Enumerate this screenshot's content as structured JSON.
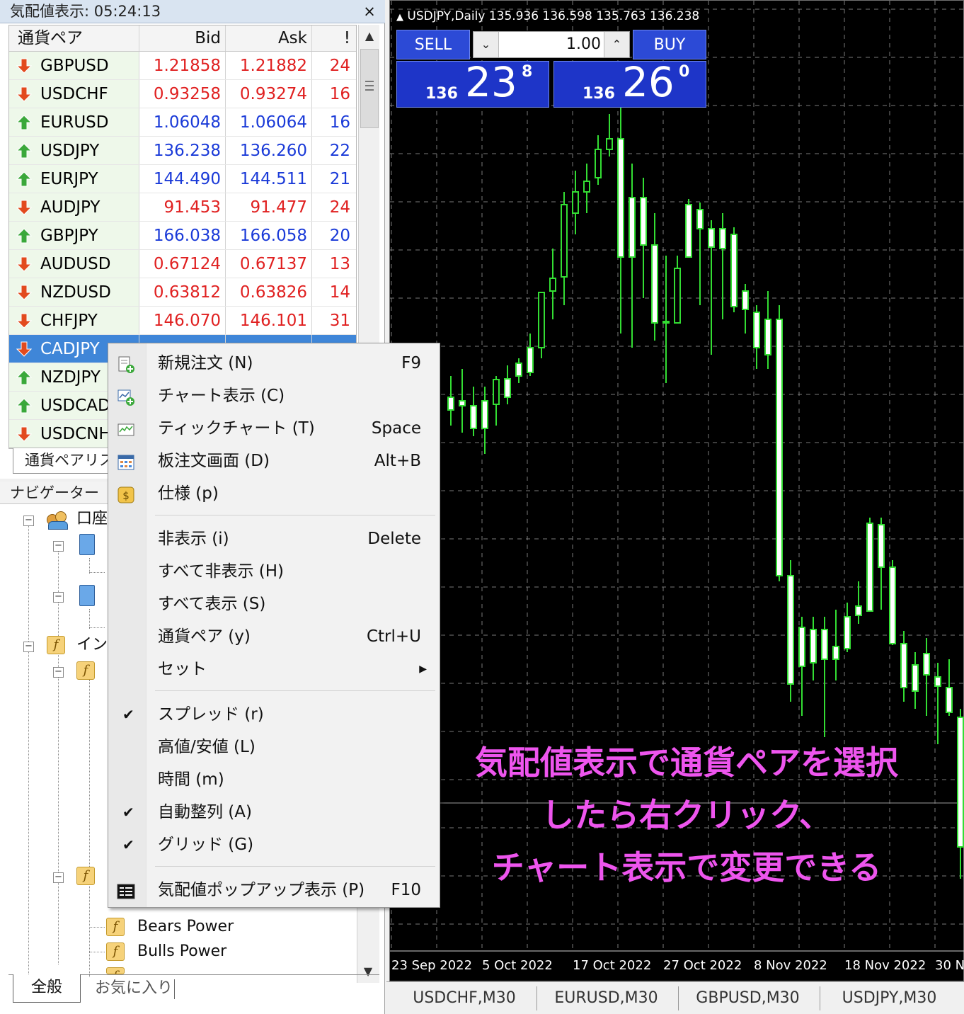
{
  "market_watch": {
    "title": "気配値表示: 05:24:13",
    "close": "×",
    "columns": [
      "通貨ペア",
      "Bid",
      "Ask",
      "!"
    ],
    "rows": [
      {
        "symbol": "GBPUSD",
        "bid": "1.21858",
        "ask": "1.21882",
        "spread": "24",
        "dir": "down"
      },
      {
        "symbol": "USDCHF",
        "bid": "0.93258",
        "ask": "0.93274",
        "spread": "16",
        "dir": "down"
      },
      {
        "symbol": "EURUSD",
        "bid": "1.06048",
        "ask": "1.06064",
        "spread": "16",
        "dir": "up"
      },
      {
        "symbol": "USDJPY",
        "bid": "136.238",
        "ask": "136.260",
        "spread": "22",
        "dir": "up"
      },
      {
        "symbol": "EURJPY",
        "bid": "144.490",
        "ask": "144.511",
        "spread": "21",
        "dir": "up"
      },
      {
        "symbol": "AUDJPY",
        "bid": "91.453",
        "ask": "91.477",
        "spread": "24",
        "dir": "down"
      },
      {
        "symbol": "GBPJPY",
        "bid": "166.038",
        "ask": "166.058",
        "spread": "20",
        "dir": "up"
      },
      {
        "symbol": "AUDUSD",
        "bid": "0.67124",
        "ask": "0.67137",
        "spread": "13",
        "dir": "down"
      },
      {
        "symbol": "NZDUSD",
        "bid": "0.63812",
        "ask": "0.63826",
        "spread": "14",
        "dir": "down"
      },
      {
        "symbol": "CHFJPY",
        "bid": "146.070",
        "ask": "146.101",
        "spread": "31",
        "dir": "down"
      },
      {
        "symbol": "CADJPY",
        "bid": "",
        "ask": "",
        "spread": "",
        "dir": "down",
        "selected": true
      },
      {
        "symbol": "NZDJPY",
        "bid": "",
        "ask": "",
        "spread": "",
        "dir": "up"
      },
      {
        "symbol": "USDCAD",
        "bid": "",
        "ask": "",
        "spread": "",
        "dir": "up"
      },
      {
        "symbol": "USDCNH",
        "bid": "",
        "ask": "",
        "spread": "",
        "dir": "down"
      }
    ],
    "tab": "通貨ペアリス"
  },
  "navigator": {
    "title": "ナビゲーター",
    "items": [
      "口座",
      "イン",
      "Bears Power",
      "Bulls Power"
    ],
    "tabs": [
      "全般",
      "お気に入り"
    ]
  },
  "chart": {
    "header": "USDJPY,Daily  135.936 136.598 135.763 136.238",
    "sell_label": "SELL",
    "buy_label": "BUY",
    "lots": "1.00",
    "sell_price": {
      "small": "136",
      "big": "23",
      "sup": "8"
    },
    "buy_price": {
      "small": "136",
      "big": "26",
      "sup": "0"
    },
    "date_labels": [
      "23 Sep 2022",
      "5 Oct 2022",
      "17 Oct 2022",
      "27 Oct 2022",
      "8 Nov 2022",
      "18 Nov 2022",
      "30 No"
    ],
    "tabs": [
      "USDCHF,M30",
      "EURUSD,M30",
      "GBPUSD,M30",
      "USDJPY,M30"
    ],
    "annotation": [
      "気配値表示で通貨ペアを選択",
      "したら右クリック、",
      "チャート表示で変更できる"
    ],
    "colors": {
      "up_candle": "#ffffff",
      "down_candle": "#000000",
      "wick": "#33dd33",
      "grid": "#7a7a7a",
      "background": "#000000"
    }
  },
  "context_menu": {
    "items": [
      {
        "label": "新規注文 (N)",
        "shortcut": "F9",
        "icon": "new-order-icon"
      },
      {
        "label": "チャート表示 (C)",
        "shortcut": "",
        "icon": "chart-window-icon"
      },
      {
        "label": "ティックチャート (T)",
        "shortcut": "Space",
        "icon": "tick-chart-icon"
      },
      {
        "label": "板注文画面 (D)",
        "shortcut": "Alt+B",
        "icon": "depth-of-market-icon"
      },
      {
        "label": "仕様 (p)",
        "shortcut": "",
        "icon": "specification-icon"
      },
      {
        "label": "非表示 (i)",
        "shortcut": "Delete"
      },
      {
        "label": "すべて非表示 (H)",
        "shortcut": ""
      },
      {
        "label": "すべて表示 (S)",
        "shortcut": ""
      },
      {
        "label": "通貨ペア (y)",
        "shortcut": "Ctrl+U"
      },
      {
        "label": "セット",
        "shortcut": "",
        "submenu": true
      },
      {
        "label": "スプレッド (r)",
        "shortcut": "",
        "checked": true
      },
      {
        "label": "高値/安値 (L)",
        "shortcut": ""
      },
      {
        "label": "時間 (m)",
        "shortcut": ""
      },
      {
        "label": "自動整列 (A)",
        "shortcut": "",
        "checked": true
      },
      {
        "label": "グリッド (G)",
        "shortcut": "",
        "checked": true
      },
      {
        "label": "気配値ポップアップ表示 (P)",
        "shortcut": "F10",
        "icon": "popup-prices-icon"
      }
    ]
  }
}
